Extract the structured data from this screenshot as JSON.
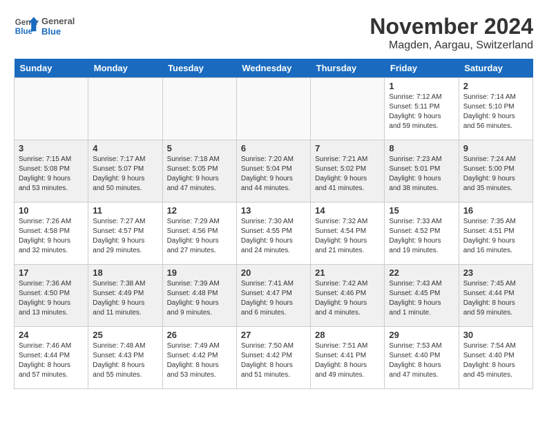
{
  "header": {
    "logo_general": "General",
    "logo_blue": "Blue",
    "month": "November 2024",
    "location": "Magden, Aargau, Switzerland"
  },
  "weekdays": [
    "Sunday",
    "Monday",
    "Tuesday",
    "Wednesday",
    "Thursday",
    "Friday",
    "Saturday"
  ],
  "weeks": [
    [
      {
        "day": "",
        "info": "",
        "empty": true
      },
      {
        "day": "",
        "info": "",
        "empty": true
      },
      {
        "day": "",
        "info": "",
        "empty": true
      },
      {
        "day": "",
        "info": "",
        "empty": true
      },
      {
        "day": "",
        "info": "",
        "empty": true
      },
      {
        "day": "1",
        "info": "Sunrise: 7:12 AM\nSunset: 5:11 PM\nDaylight: 9 hours and 59 minutes."
      },
      {
        "day": "2",
        "info": "Sunrise: 7:14 AM\nSunset: 5:10 PM\nDaylight: 9 hours and 56 minutes."
      }
    ],
    [
      {
        "day": "3",
        "info": "Sunrise: 7:15 AM\nSunset: 5:08 PM\nDaylight: 9 hours and 53 minutes."
      },
      {
        "day": "4",
        "info": "Sunrise: 7:17 AM\nSunset: 5:07 PM\nDaylight: 9 hours and 50 minutes."
      },
      {
        "day": "5",
        "info": "Sunrise: 7:18 AM\nSunset: 5:05 PM\nDaylight: 9 hours and 47 minutes."
      },
      {
        "day": "6",
        "info": "Sunrise: 7:20 AM\nSunset: 5:04 PM\nDaylight: 9 hours and 44 minutes."
      },
      {
        "day": "7",
        "info": "Sunrise: 7:21 AM\nSunset: 5:02 PM\nDaylight: 9 hours and 41 minutes."
      },
      {
        "day": "8",
        "info": "Sunrise: 7:23 AM\nSunset: 5:01 PM\nDaylight: 9 hours and 38 minutes."
      },
      {
        "day": "9",
        "info": "Sunrise: 7:24 AM\nSunset: 5:00 PM\nDaylight: 9 hours and 35 minutes."
      }
    ],
    [
      {
        "day": "10",
        "info": "Sunrise: 7:26 AM\nSunset: 4:58 PM\nDaylight: 9 hours and 32 minutes."
      },
      {
        "day": "11",
        "info": "Sunrise: 7:27 AM\nSunset: 4:57 PM\nDaylight: 9 hours and 29 minutes."
      },
      {
        "day": "12",
        "info": "Sunrise: 7:29 AM\nSunset: 4:56 PM\nDaylight: 9 hours and 27 minutes."
      },
      {
        "day": "13",
        "info": "Sunrise: 7:30 AM\nSunset: 4:55 PM\nDaylight: 9 hours and 24 minutes."
      },
      {
        "day": "14",
        "info": "Sunrise: 7:32 AM\nSunset: 4:54 PM\nDaylight: 9 hours and 21 minutes."
      },
      {
        "day": "15",
        "info": "Sunrise: 7:33 AM\nSunset: 4:52 PM\nDaylight: 9 hours and 19 minutes."
      },
      {
        "day": "16",
        "info": "Sunrise: 7:35 AM\nSunset: 4:51 PM\nDaylight: 9 hours and 16 minutes."
      }
    ],
    [
      {
        "day": "17",
        "info": "Sunrise: 7:36 AM\nSunset: 4:50 PM\nDaylight: 9 hours and 13 minutes."
      },
      {
        "day": "18",
        "info": "Sunrise: 7:38 AM\nSunset: 4:49 PM\nDaylight: 9 hours and 11 minutes."
      },
      {
        "day": "19",
        "info": "Sunrise: 7:39 AM\nSunset: 4:48 PM\nDaylight: 9 hours and 9 minutes."
      },
      {
        "day": "20",
        "info": "Sunrise: 7:41 AM\nSunset: 4:47 PM\nDaylight: 9 hours and 6 minutes."
      },
      {
        "day": "21",
        "info": "Sunrise: 7:42 AM\nSunset: 4:46 PM\nDaylight: 9 hours and 4 minutes."
      },
      {
        "day": "22",
        "info": "Sunrise: 7:43 AM\nSunset: 4:45 PM\nDaylight: 9 hours and 1 minute."
      },
      {
        "day": "23",
        "info": "Sunrise: 7:45 AM\nSunset: 4:44 PM\nDaylight: 8 hours and 59 minutes."
      }
    ],
    [
      {
        "day": "24",
        "info": "Sunrise: 7:46 AM\nSunset: 4:44 PM\nDaylight: 8 hours and 57 minutes."
      },
      {
        "day": "25",
        "info": "Sunrise: 7:48 AM\nSunset: 4:43 PM\nDaylight: 8 hours and 55 minutes."
      },
      {
        "day": "26",
        "info": "Sunrise: 7:49 AM\nSunset: 4:42 PM\nDaylight: 8 hours and 53 minutes."
      },
      {
        "day": "27",
        "info": "Sunrise: 7:50 AM\nSunset: 4:42 PM\nDaylight: 8 hours and 51 minutes."
      },
      {
        "day": "28",
        "info": "Sunrise: 7:51 AM\nSunset: 4:41 PM\nDaylight: 8 hours and 49 minutes."
      },
      {
        "day": "29",
        "info": "Sunrise: 7:53 AM\nSunset: 4:40 PM\nDaylight: 8 hours and 47 minutes."
      },
      {
        "day": "30",
        "info": "Sunrise: 7:54 AM\nSunset: 4:40 PM\nDaylight: 8 hours and 45 minutes."
      }
    ]
  ]
}
